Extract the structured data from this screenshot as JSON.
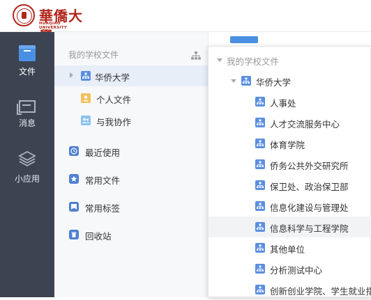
{
  "header": {
    "logo_cn": "華僑大學",
    "logo_en": "HUAQIAO UNIVERSITY"
  },
  "rail": {
    "items": [
      {
        "label": "文件",
        "icon": "folder-icon",
        "active": true
      },
      {
        "label": "消息",
        "icon": "message-icon",
        "active": false
      },
      {
        "label": "小应用",
        "icon": "apps-icon",
        "active": false
      }
    ]
  },
  "files": {
    "title": "我的学校文件",
    "tree": [
      {
        "label": "华侨大学",
        "icon": "org-icon",
        "selected": true
      },
      {
        "label": "个人文件",
        "icon": "user-icon"
      },
      {
        "label": "与我协作",
        "icon": "team-icon"
      }
    ],
    "menu": [
      {
        "label": "最近使用",
        "icon": "clock-icon"
      },
      {
        "label": "常用文件",
        "icon": "star-icon"
      },
      {
        "label": "常用标签",
        "icon": "tag-icon"
      },
      {
        "label": "回收站",
        "icon": "trash-icon"
      }
    ]
  },
  "dropdown": {
    "root": "我的学校文件",
    "org": "华侨大学",
    "units": [
      "人事处",
      "人才交流服务中心",
      "体育学院",
      "侨务公共外交研究所",
      "保卫处、政治保卫部",
      "信息化建设与管理处",
      "信息科学与工程学院",
      "其他单位",
      "分析测试中心",
      "创新创业学院、学生就业指"
    ],
    "hovered_index": 6
  },
  "colors": {
    "rail_bg": "#3c4452",
    "accent": "#4a90e2",
    "brand": "#b1261b"
  }
}
